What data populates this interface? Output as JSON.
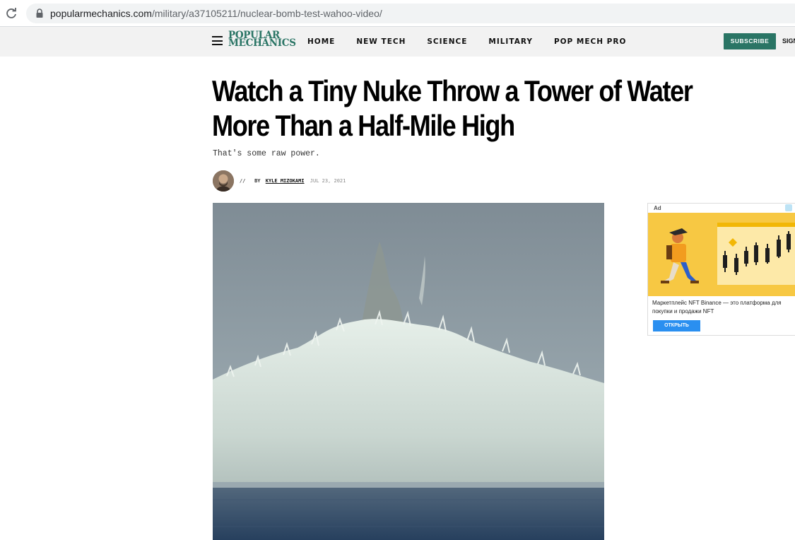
{
  "browser": {
    "url_host": "popularmechanics.com",
    "url_path": "/military/a37105211/nuclear-bomb-test-wahoo-video/"
  },
  "site": {
    "logo_line1": "POPULAR",
    "logo_line2": "MECHANICS",
    "nav": [
      "HOME",
      "NEW TECH",
      "SCIENCE",
      "MILITARY",
      "POP MECH PRO"
    ],
    "subscribe_label": "SUBSCRIBE",
    "signin_label": "SIGN",
    "brand_color": "#2a7565"
  },
  "article": {
    "headline": "Watch a Tiny Nuke Throw a Tower of Water More Than a Half-Mile High",
    "dek": "That's some raw power.",
    "byline_prefix": "//",
    "byline_by": "BY",
    "author": "KYLE MIZOKAMI",
    "date": "JUL 23, 2021"
  },
  "ad": {
    "label": "Ad",
    "text": "Маркетплейс NFT Binance — это платформа для покупки и продажи NFT",
    "cta": "ОТКРЫТЬ",
    "accent_color": "#f5c518"
  },
  "icons": [
    "reload-icon",
    "lock-icon",
    "hamburger-icon",
    "ad-choices-icon"
  ]
}
